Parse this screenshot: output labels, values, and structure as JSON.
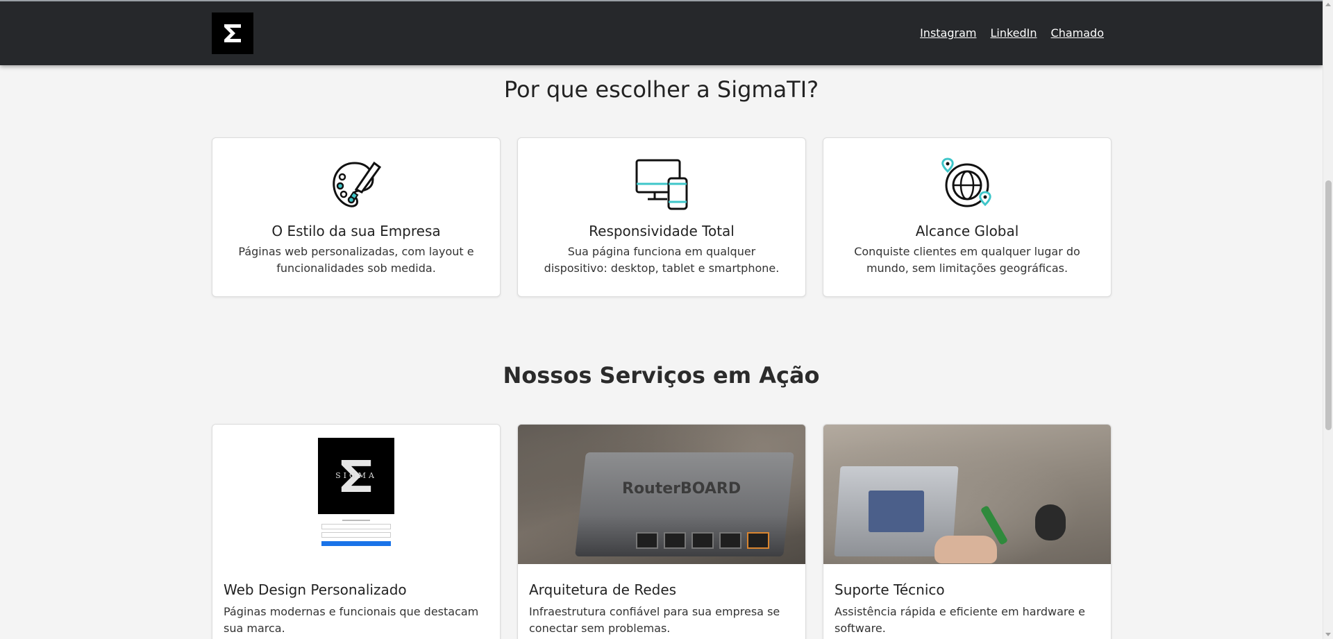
{
  "header": {
    "logo_icon": "sigma-logo-icon",
    "nav": [
      {
        "label": "Instagram"
      },
      {
        "label": "LinkedIn"
      },
      {
        "label": "Chamado"
      }
    ]
  },
  "why": {
    "title": "Por que escolher a SigmaTI?",
    "cards": [
      {
        "icon": "palette-brush-icon",
        "title": "O Estilo da sua Empresa",
        "text": "Páginas web personalizadas, com layout e funcionalidades sob medida."
      },
      {
        "icon": "devices-icon",
        "title": "Responsividade Total",
        "text": "Sua página funciona em qualquer dispositivo: desktop, tablet e smartphone."
      },
      {
        "icon": "globe-pin-icon",
        "title": "Alcance Global",
        "text": "Conquiste clientes em qualquer lugar do mundo, sem limitações geográficas."
      }
    ]
  },
  "services": {
    "title": "Nossos Serviços em Ação",
    "cards": [
      {
        "title": "Web Design Personalizado",
        "text": "Páginas modernas e funcionais que destacam sua marca.",
        "image": "web-design-preview",
        "preview_brand": "SIGMA"
      },
      {
        "title": "Arquitetura de Redes",
        "text": "Infraestrutura confiável para sua empresa se conectar sem problemas.",
        "image": "router-photo",
        "photo_label": "RouterBOARD"
      },
      {
        "title": "Suporte Técnico",
        "text": "Assistência rápida e eficiente em hardware e software.",
        "image": "hardware-support-photo"
      }
    ]
  },
  "colors": {
    "header_bg": "#26282b",
    "accent_teal": "#3ec6c9",
    "page_bg": "#f4f4f4"
  }
}
